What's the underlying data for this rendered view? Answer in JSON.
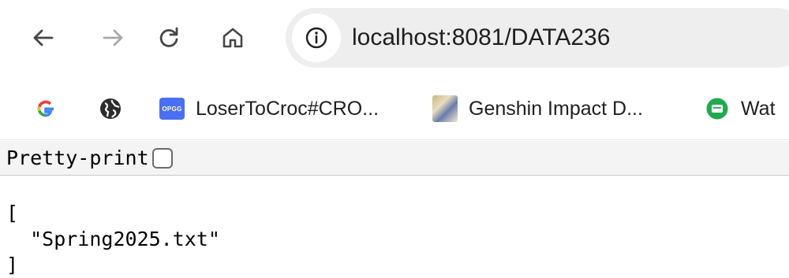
{
  "toolbar": {
    "back_icon": "arrow-left-icon",
    "forward_icon": "arrow-right-icon",
    "reload_icon": "reload-icon",
    "home_icon": "home-icon",
    "site_info_icon": "info-icon",
    "url": "localhost:8081/DATA236"
  },
  "bookmarks": [
    {
      "icon": "google-icon",
      "label": ""
    },
    {
      "icon": "globe-icon",
      "label": ""
    },
    {
      "icon": "opgg-icon",
      "icon_text": "OPGG",
      "label": "LoserToCroc#CRO..."
    },
    {
      "icon": "genshin-icon",
      "label": "Genshin Impact D..."
    },
    {
      "icon": "chat-icon",
      "label": "Wat"
    }
  ],
  "pretty_print": {
    "label": "Pretty-print",
    "checked": false
  },
  "json_content": {
    "open": "[",
    "item": "  \"Spring2025.txt\"",
    "close": "]"
  }
}
